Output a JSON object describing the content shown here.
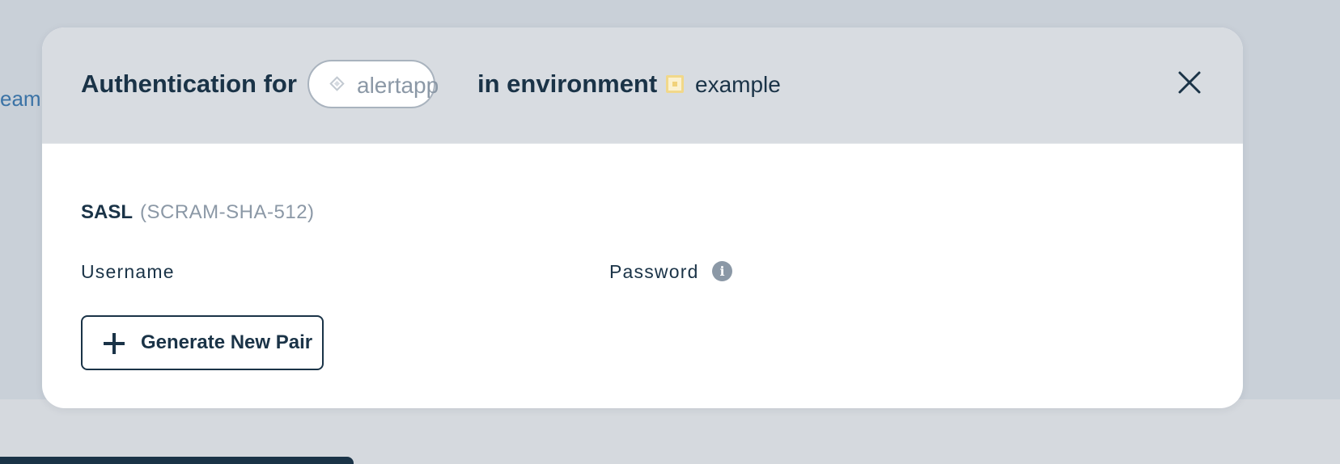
{
  "background": {
    "link_text": "eam"
  },
  "modal": {
    "title_prefix": "Authentication for",
    "app_name": "alertapp",
    "title_middle": "in environment",
    "environment_name": "example",
    "section": {
      "title": "SASL",
      "subtitle": "(SCRAM-SHA-512)"
    },
    "fields": {
      "username_label": "Username",
      "password_label": "Password",
      "info_glyph": "i"
    },
    "generate_button_label": "Generate New Pair"
  },
  "colors": {
    "text_primary": "#1a3347",
    "text_muted": "#8b98a6",
    "environment_accent": "#f1d27a",
    "header_background": "#d8dce1",
    "overlay_background": "#c9d0d8"
  },
  "icons": {
    "app": "application-diamond-icon",
    "environment": "environment-square-icon",
    "close": "close-icon",
    "info": "info-icon",
    "add": "plus-icon"
  }
}
